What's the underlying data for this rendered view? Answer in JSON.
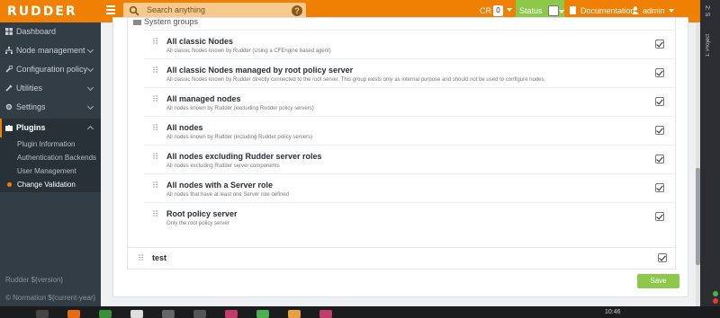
{
  "header": {
    "logo": "RUDDER",
    "search_placeholder": "Search anything",
    "help_glyph": "?",
    "cr_label": "CR",
    "cr_count": "0",
    "status_label": "Status",
    "documentation_label": "Documentation",
    "user_label": "admin"
  },
  "sidebar": {
    "items": [
      {
        "label": "Dashboard",
        "icon": "dashboard-icon"
      },
      {
        "label": "Node management",
        "icon": "sitemap-icon"
      },
      {
        "label": "Configuration policy",
        "icon": "wrench-icon"
      },
      {
        "label": "Utilities",
        "icon": "tools-icon"
      },
      {
        "label": "Settings",
        "icon": "gear-icon"
      },
      {
        "label": "Plugins",
        "icon": "puzzle-icon"
      }
    ],
    "plugin_subitems": [
      "Plugin Information",
      "Authentication Backends",
      "User Management",
      "Change Validation"
    ],
    "footer_version": "Rudder ${version}",
    "footer_copyright": "© Normation ${current-year}"
  },
  "tree": {
    "parent_label": "System groups",
    "groups": [
      {
        "name": "All classic Nodes",
        "description": "All classic Nodes known by Rudder (Using a CFEngine based agent)",
        "checked": true
      },
      {
        "name": "All classic Nodes managed by root policy server",
        "description": "All classic Nodes known by Rudder directly connected to the root server. This group exists only as internal purpose and should not be used to configure nodes.",
        "checked": true
      },
      {
        "name": "All managed nodes",
        "description": "All nodes known by Rudder (excluding Rudder policy servers)",
        "checked": true
      },
      {
        "name": "All nodes",
        "description": "All nodes known by Rudder (including Rudder policy servers)",
        "checked": true
      },
      {
        "name": "All nodes excluding Rudder server roles",
        "description": "All nodes excluding Rudder server components",
        "checked": true
      },
      {
        "name": "All nodes with a Server role",
        "description": "All nodes that have at least one Server role defined",
        "checked": true
      },
      {
        "name": "Root policy server",
        "description": "Only the root policy server",
        "checked": true
      }
    ],
    "test_group": {
      "name": "test",
      "checked": true
    }
  },
  "actions": {
    "save_label": "Save"
  },
  "ide_strip": {
    "label_top": "2: S",
    "label_project": "1: Project"
  },
  "taskbar": {
    "clock": "10:46"
  },
  "colors": {
    "brand_orange": "#f08004",
    "status_green": "#8ec84a",
    "sidebar_bg": "#333d45"
  }
}
